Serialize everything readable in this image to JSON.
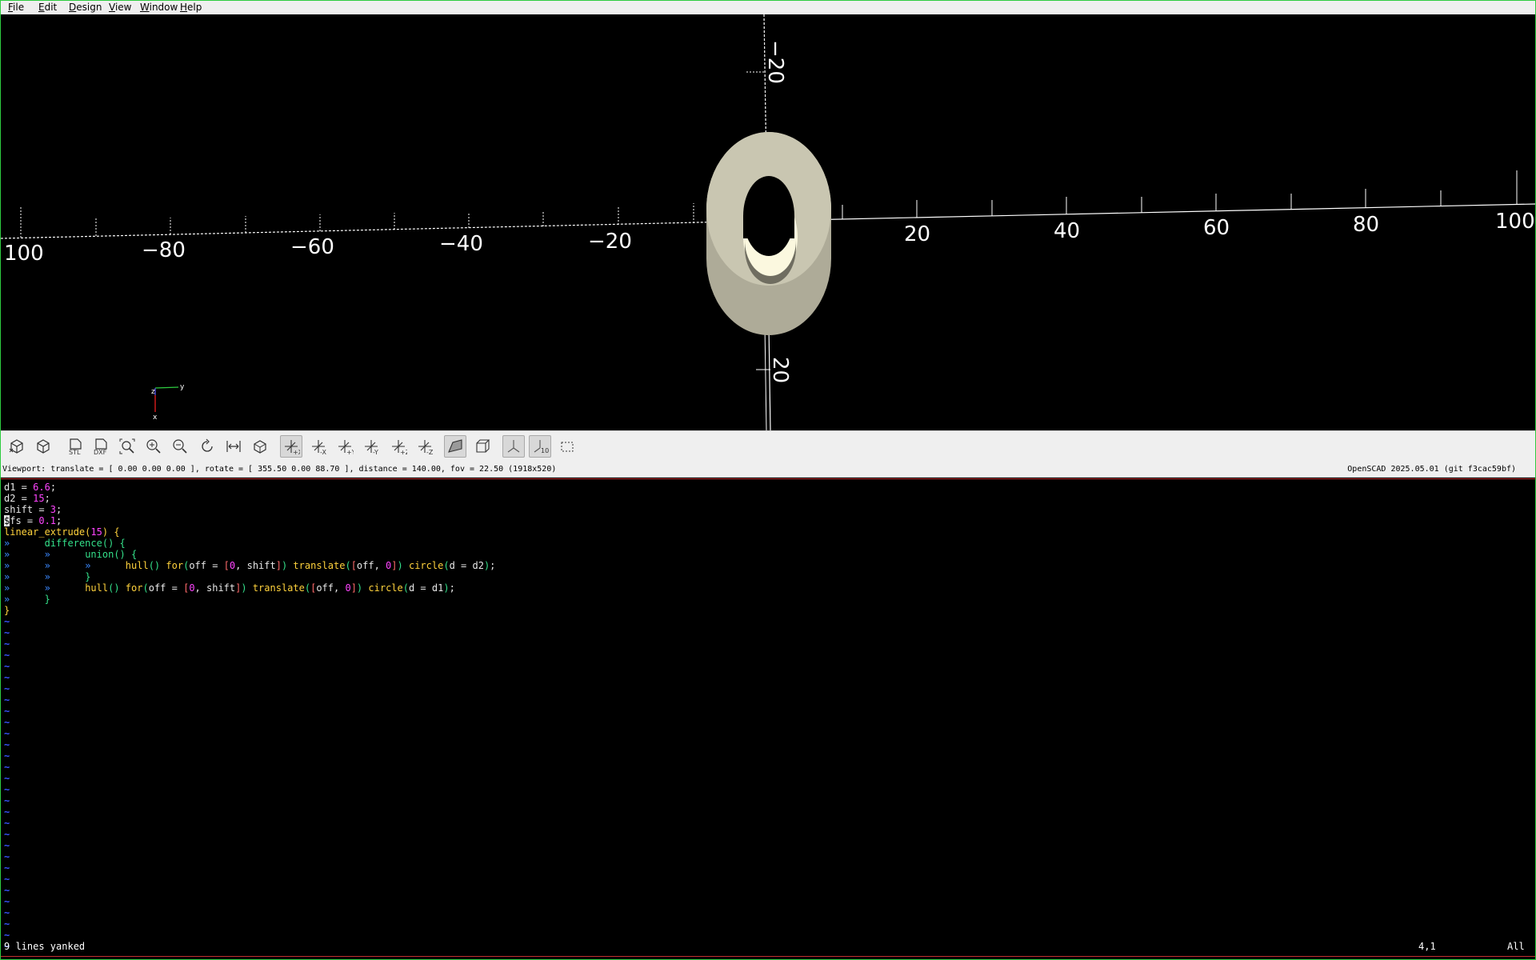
{
  "menu": [
    {
      "label": "File",
      "key": "F",
      "rest": "ile"
    },
    {
      "label": "Edit",
      "key": "E",
      "rest": "dit"
    },
    {
      "label": "Design",
      "key": "D",
      "rest": "esign"
    },
    {
      "label": "View",
      "key": "V",
      "rest": "iew"
    },
    {
      "label": "Window",
      "key": "W",
      "rest": "indow"
    },
    {
      "label": "Help",
      "key": "H",
      "rest": "elp"
    }
  ],
  "viewport": {
    "x_axis_labels": [
      "100",
      "−80",
      "−60",
      "−40",
      "−20",
      "20",
      "40",
      "60",
      "80",
      "100"
    ],
    "y_axis_labels": [
      "−20",
      "20"
    ],
    "gizmo": {
      "z": "z",
      "y": "y",
      "x": "x"
    },
    "model_color": "#c9c6b1",
    "bg_color": "#000000"
  },
  "toolbar": {
    "stl_label": "STL",
    "dxf_label": "DXF",
    "view_labels": [
      "+X",
      "-X",
      "+Y",
      "-Y",
      "+Z",
      "-Z"
    ],
    "scale_label": "10"
  },
  "status": {
    "viewport_info": "Viewport: translate = [ 0.00 0.00 0.00 ], rotate = [ 355.50 0.00 88.70 ], distance = 140.00, fov = 22.50 (1918x520)",
    "version": "OpenSCAD 2025.05.01 (git f3cac59bf)"
  },
  "editor": {
    "code_lines": [
      "d1 = 6.6;",
      "d2 = 15;",
      "shift = 3;",
      "$fs = 0.1;",
      "linear_extrude(15) {",
      "»\tdifference() {",
      "»\t»\tunion() {",
      "»\t»\t»\thull() for(off = [0, shift]) translate([off, 0]) circle(d = d2);",
      "»\t»\t}",
      "»\t»\thull() for(off = [0, shift]) translate([off, 0]) circle(d = d1);",
      "»\t}",
      "}"
    ],
    "tilde_count": 30,
    "tilde_char": "~",
    "tab_char": "»",
    "command_line": "9 lines yanked",
    "cursor_pos": "4,1",
    "scroll_pos": "All"
  }
}
